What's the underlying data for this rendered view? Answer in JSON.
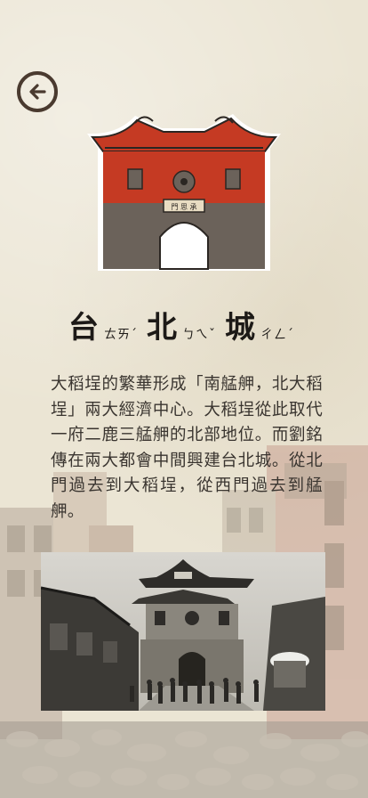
{
  "nav": {
    "back_label": "Back"
  },
  "title": {
    "parts": [
      {
        "char": "台",
        "ruby": "ㄊㄞˊ"
      },
      {
        "char": "北",
        "ruby": "ㄅㄟˇ"
      },
      {
        "char": "城",
        "ruby": "ㄔㄥˊ"
      }
    ]
  },
  "description": "大稻埕的繁華形成「南艋舺，北大稻埕」兩大經濟中心。大稻埕從此取代一府二鹿三艋舺的北部地位。而劉銘傳在兩大都會中間興建台北城。從北門過去到大稻埕，從西門過去到艋舺。",
  "gate_icon": {
    "plaque_text": "門 思 承",
    "colors": {
      "roof": "#c53a23",
      "wall": "#6b625a",
      "outline": "#ffffff",
      "ink": "#2b2622"
    }
  },
  "photo": {
    "alt": "historic photo of the North Gate street scene"
  }
}
